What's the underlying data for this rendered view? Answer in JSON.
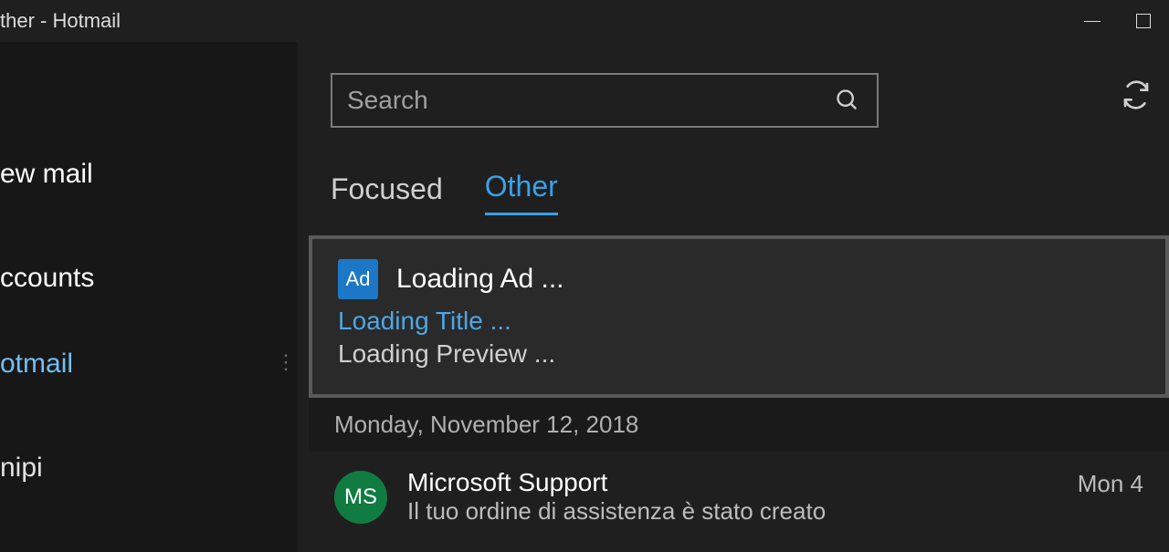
{
  "titlebar": {
    "title": "ther - Hotmail"
  },
  "sidebar": {
    "new_mail": "ew mail",
    "accounts_heading": "ccounts",
    "account": "otmail",
    "folder": "nipi"
  },
  "search": {
    "placeholder": "Search"
  },
  "tabs": {
    "focused": "Focused",
    "other": "Other"
  },
  "ad": {
    "badge": "Ad",
    "loading": "Loading Ad ...",
    "title": "Loading Title ...",
    "preview": "Loading Preview ..."
  },
  "list": {
    "date_header": "Monday, November 12, 2018",
    "messages": [
      {
        "initials": "MS",
        "sender": "Microsoft Support",
        "subject": "Il tuo ordine di assistenza è stato creato",
        "time": "Mon 4",
        "avatar_color": "#107c41"
      }
    ]
  }
}
